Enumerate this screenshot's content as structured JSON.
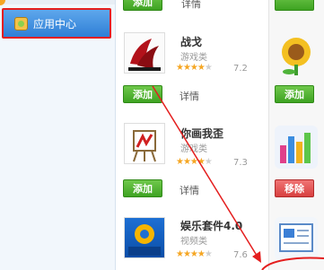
{
  "sidebar": {
    "app_center_label": "应用中心"
  },
  "apps": [
    {
      "name": "",
      "category": "",
      "rating_label": "",
      "add_label": "添加",
      "detail_label": "详情"
    },
    {
      "name": "战戈",
      "category": "游戏类",
      "rating_label": "7.2",
      "stars": 4,
      "add_label": "添加",
      "detail_label": "详情",
      "icon_text": "战戈"
    },
    {
      "name": "你画我歪",
      "category": "游戏类",
      "rating_label": "7.3",
      "stars": 4,
      "add_label": "添加",
      "detail_label": "详情"
    },
    {
      "name": "娱乐套件4.0",
      "category": "视频类",
      "rating_label": "7.6",
      "stars": 4,
      "add_label": "",
      "detail_label": "",
      "icon_text": "娱乐套件"
    }
  ],
  "right_column": {
    "remove_label": "移除",
    "add_label": "添加"
  },
  "colors": {
    "accent_green": "#3ea322",
    "selection_red": "#e41e1e",
    "sidebar_blue": "#2f7fd6"
  }
}
